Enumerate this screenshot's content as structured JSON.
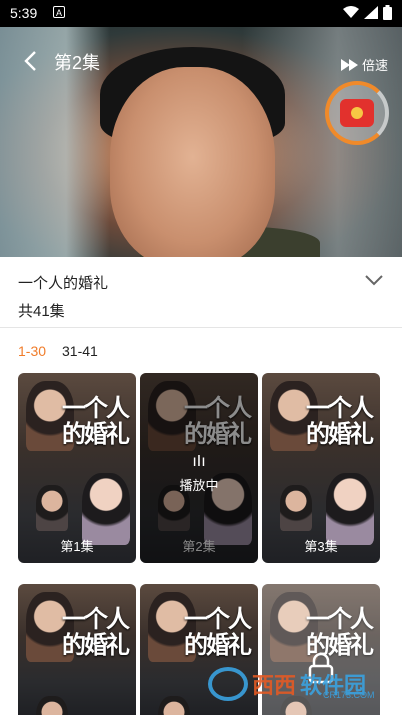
{
  "status_bar": {
    "time": "5:39",
    "sim_badge": "A"
  },
  "player": {
    "episode_title": "第2集",
    "speed_label": "倍速"
  },
  "drama": {
    "title": "一个人的婚礼",
    "episode_count": "共41集"
  },
  "ranges": [
    {
      "label": "1-30",
      "active": true
    },
    {
      "label": "31-41",
      "active": false
    }
  ],
  "episodes": [
    {
      "label": "第1集",
      "cover_text": "一个人的婚礼",
      "state": "normal"
    },
    {
      "label": "第2集",
      "cover_text": "一个人的婚礼",
      "state": "playing",
      "playing_text": "播放中"
    },
    {
      "label": "第3集",
      "cover_text": "一个人的婚礼",
      "state": "normal"
    },
    {
      "label": "",
      "cover_text": "一个人的婚礼",
      "state": "normal"
    },
    {
      "label": "",
      "cover_text": "一个人的婚礼",
      "state": "normal"
    },
    {
      "label": "",
      "cover_text": "一个人的婚礼",
      "state": "locked"
    }
  ],
  "watermark": {
    "text1": "西西",
    "text2": "软件园",
    "url": "CR173.COM"
  },
  "colors": {
    "accent": "#f07c2a",
    "red_packet": "#e2312d"
  }
}
